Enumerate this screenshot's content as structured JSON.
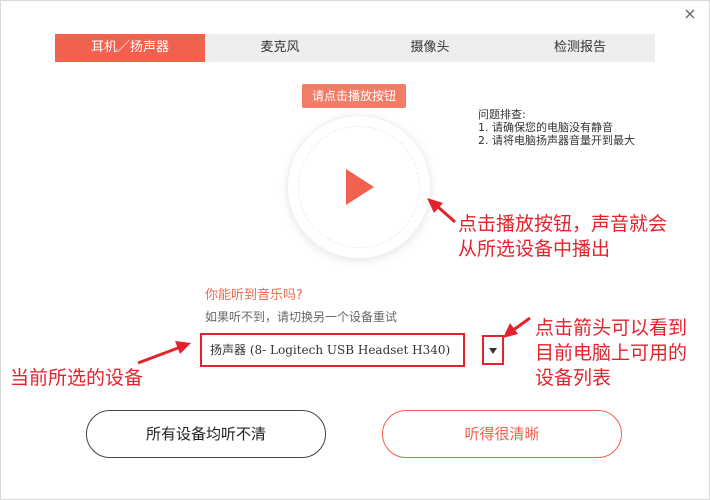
{
  "window": {
    "close_glyph": "×"
  },
  "tabs": [
    {
      "label": "耳机／扬声器",
      "active": true
    },
    {
      "label": "麦克风",
      "active": false
    },
    {
      "label": "摄像头",
      "active": false
    },
    {
      "label": "检测报告",
      "active": false
    }
  ],
  "player": {
    "hint": "请点击播放按钮",
    "icon": "play-icon"
  },
  "troubleshoot": {
    "title": "问题排查:",
    "items": [
      "1. 请确保您的电脑没有静音",
      "2. 请将电脑扬声器音量开到最大"
    ]
  },
  "question": {
    "text": "你能听到音乐吗?",
    "subtext": "如果听不到，请切换另一个设备重试"
  },
  "device": {
    "selected": "扬声器 (8- Logitech USB Headset H340)"
  },
  "annotations": {
    "play": [
      "点击播放按钮，声音就会",
      "从所选设备中播出"
    ],
    "arrow": [
      "点击箭头可以看到",
      "目前电脑上可用的",
      "设备列表"
    ],
    "device": "当前所选的设备"
  },
  "buttons": {
    "unclear": "所有设备均听不清",
    "clear": "听得很清晰"
  },
  "colors": {
    "accent": "#f2604e",
    "annotation": "#e5222c"
  }
}
